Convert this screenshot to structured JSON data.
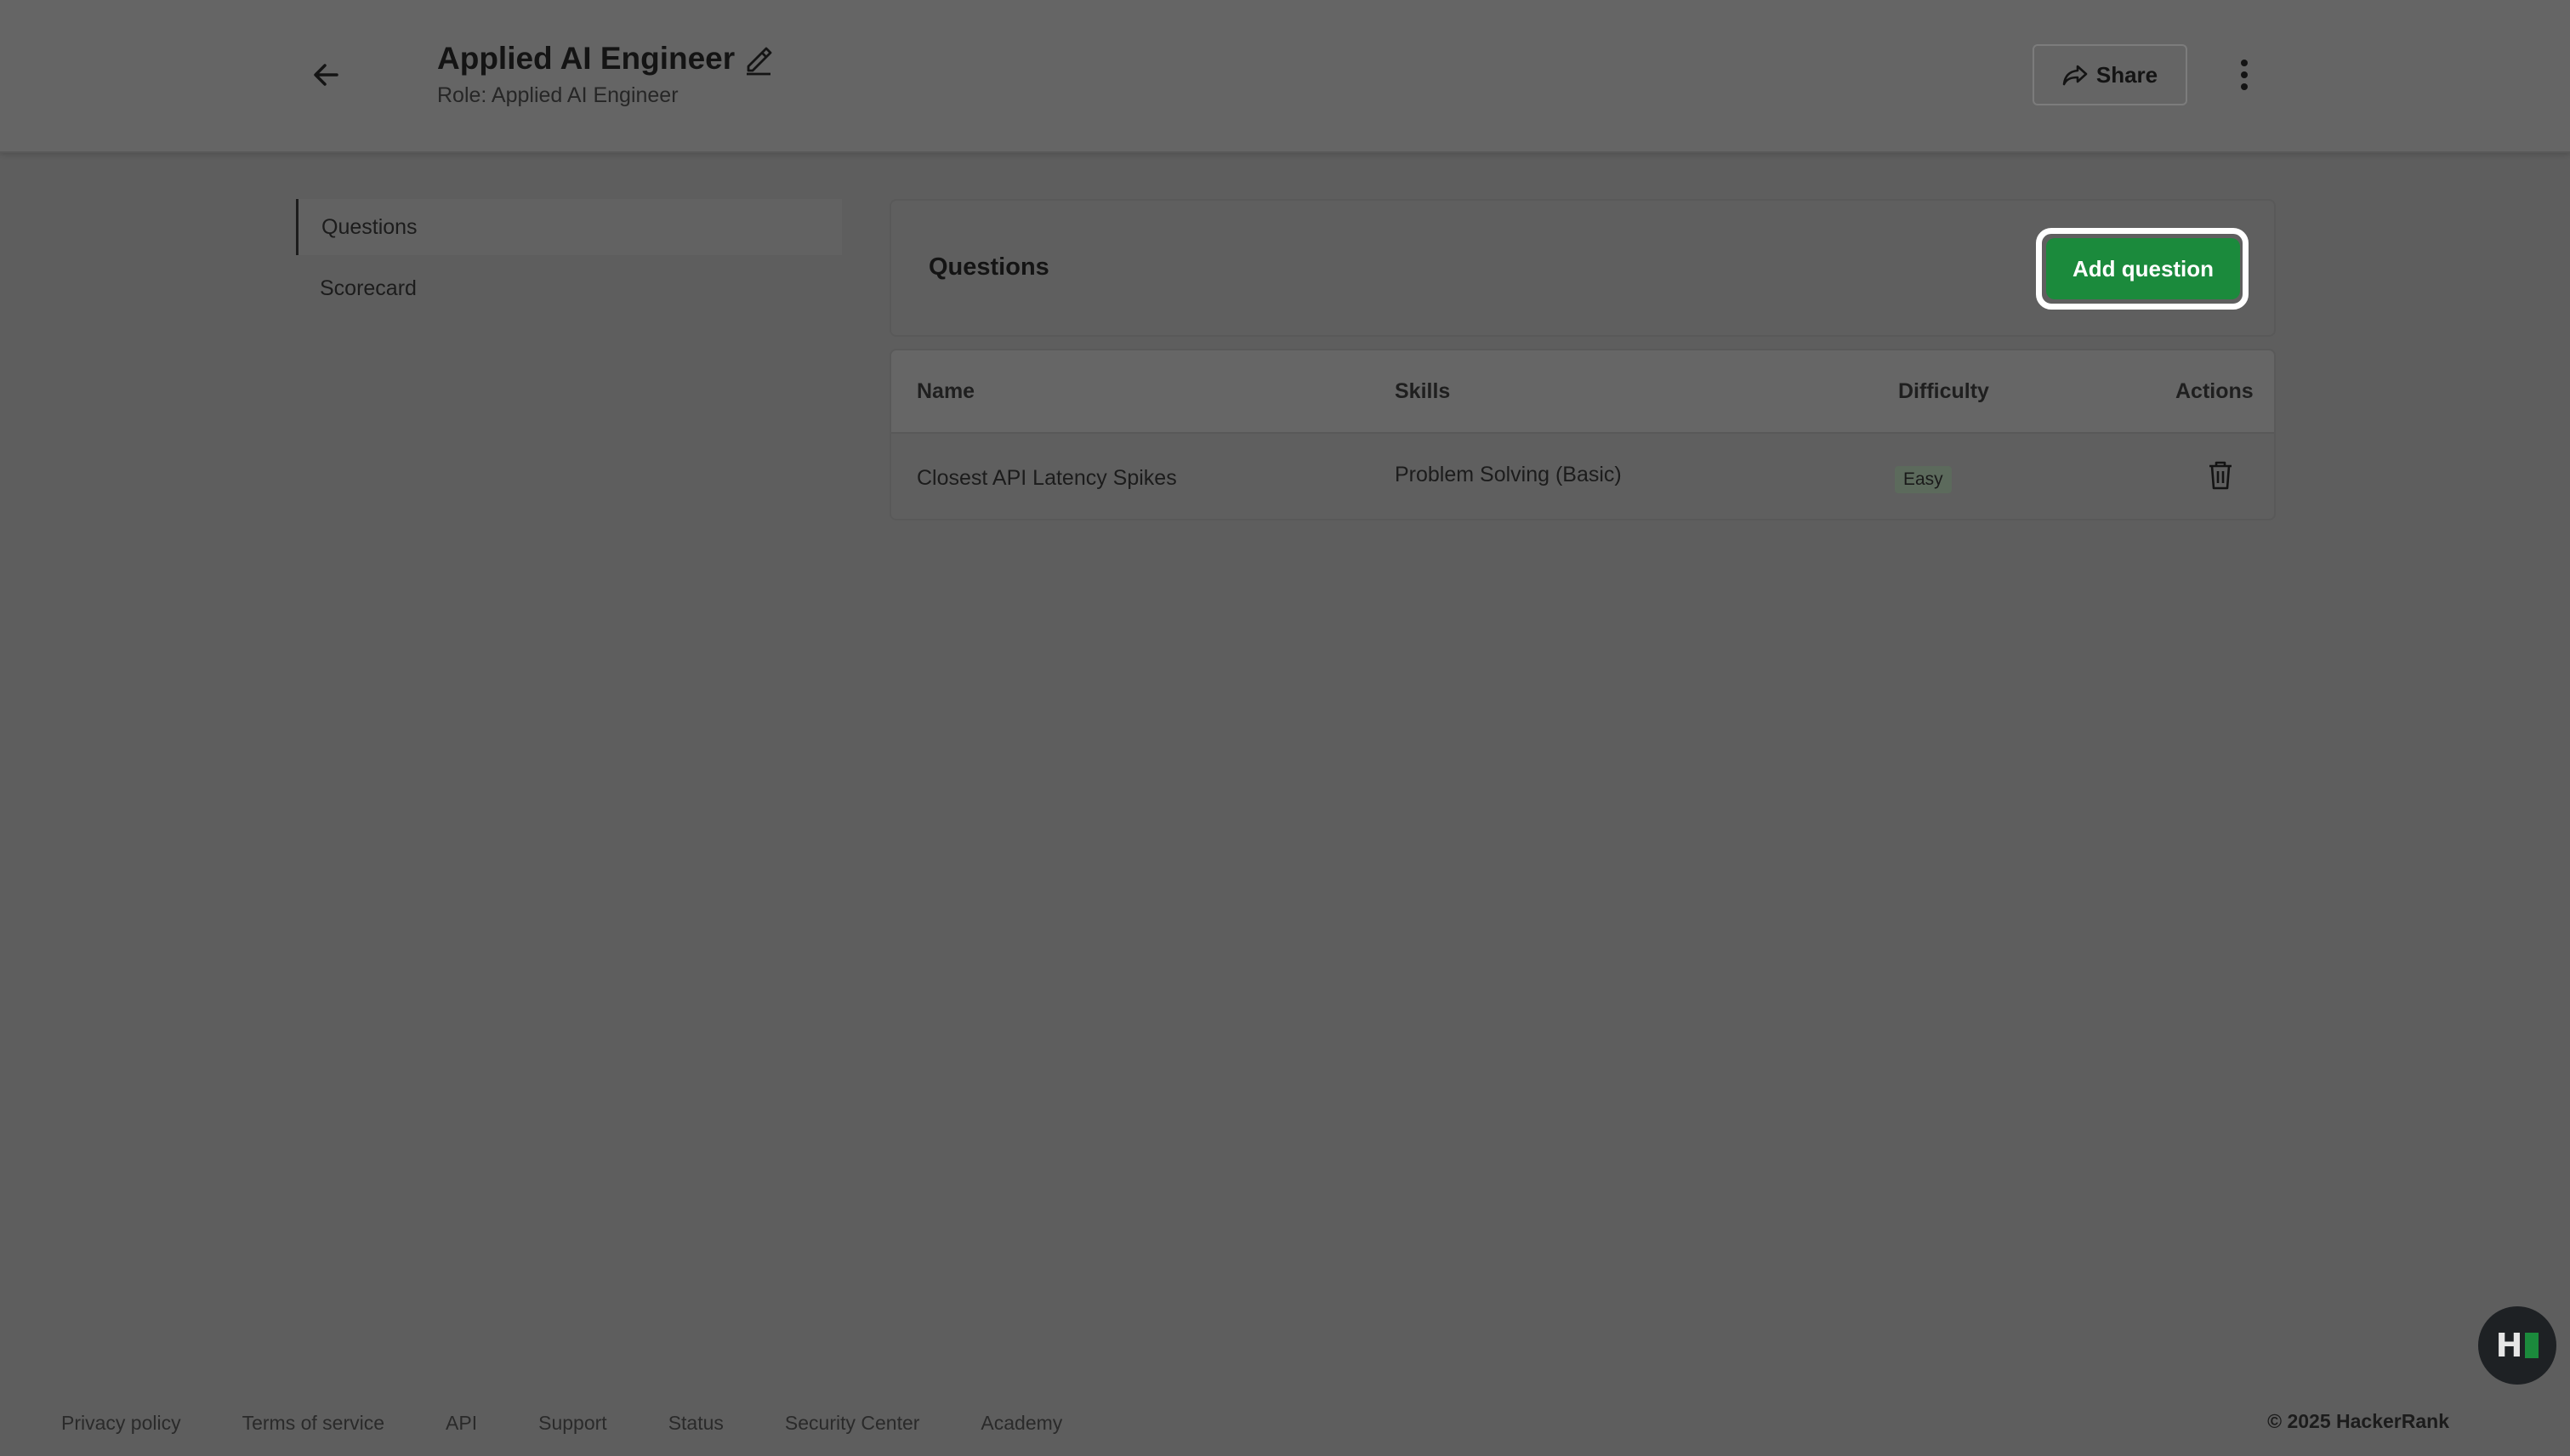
{
  "header": {
    "title": "Applied AI Engineer",
    "subtitle": "Role: Applied AI Engineer",
    "share_label": "Share",
    "icons": [
      "arrow-left-icon",
      "pencil-icon",
      "share-icon",
      "more-vertical-icon"
    ]
  },
  "sidebar": {
    "items": [
      {
        "label": "Questions",
        "active": true
      },
      {
        "label": "Scorecard",
        "active": false
      }
    ]
  },
  "questions_panel": {
    "title": "Questions",
    "add_button_label": "Add question",
    "accent_color": "#1b8a3c"
  },
  "table": {
    "headers": [
      "Name",
      "Skills",
      "Difficulty",
      "Actions"
    ],
    "rows": [
      {
        "name": "Closest API Latency Spikes",
        "skills": "Problem Solving (Basic)",
        "difficulty": "Easy",
        "action_icon": "trash-icon"
      }
    ]
  },
  "footer": {
    "links": [
      "Privacy policy",
      "Terms of service",
      "API",
      "Support",
      "Status",
      "Security Center",
      "Academy"
    ],
    "copyright": "© 2025 HackerRank"
  },
  "widget": {
    "logo_text": "H"
  }
}
